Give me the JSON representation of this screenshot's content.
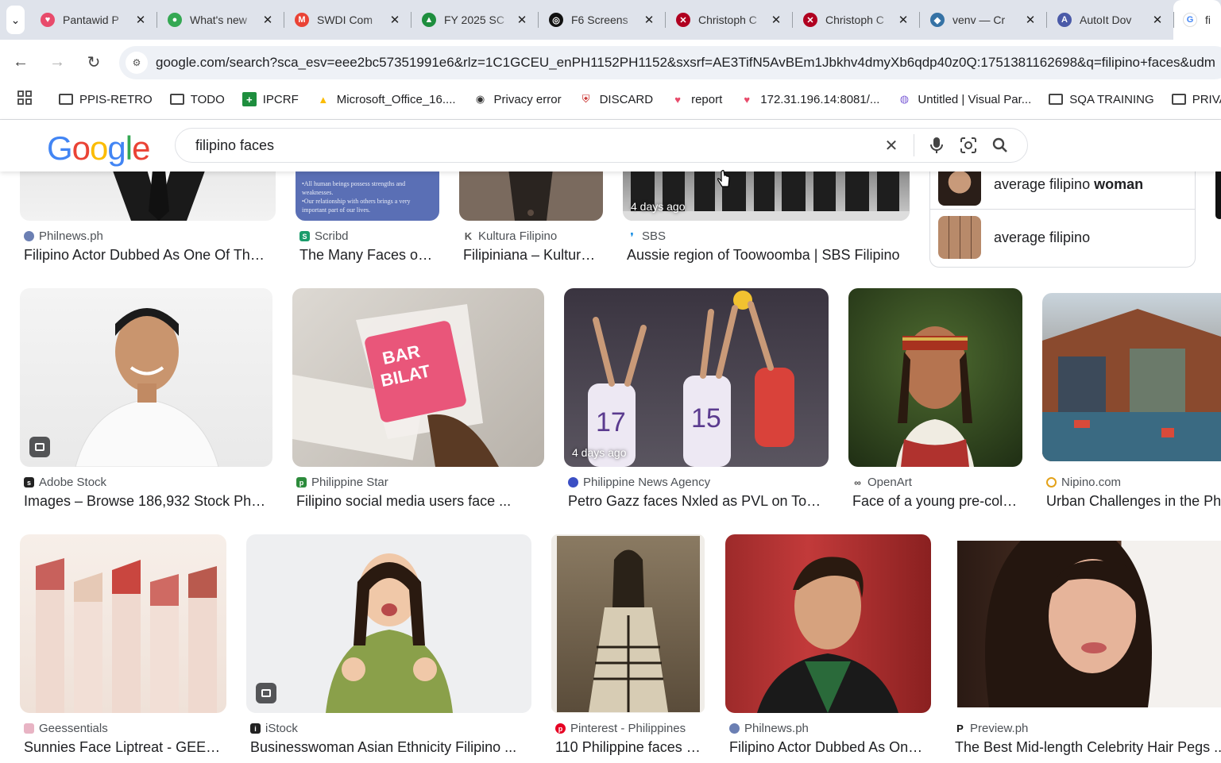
{
  "tabs": [
    {
      "title": "Pantawid P",
      "color": "#e84b6b",
      "glyph": "♥"
    },
    {
      "title": "What's new",
      "color": "#34a853",
      "glyph": "●"
    },
    {
      "title": "SWDI Com",
      "color": "#ea4335",
      "glyph": "M"
    },
    {
      "title": "FY 2025 SC",
      "color": "#1e8e3e",
      "glyph": "▲"
    },
    {
      "title": "F6 Screens",
      "color": "#111111",
      "glyph": "◎"
    },
    {
      "title": "Christoph C",
      "color": "#b00020",
      "glyph": "✕"
    },
    {
      "title": "Christoph C",
      "color": "#b00020",
      "glyph": "✕"
    },
    {
      "title": "venv — Cr",
      "color": "#3572a5",
      "glyph": "◆"
    },
    {
      "title": "AutoIt Dov",
      "color": "#4a5aa8",
      "glyph": "A"
    }
  ],
  "active_tab": {
    "title": "fi",
    "glyph": "G"
  },
  "url": "google.com/search?sca_esv=eee2bc57351991e6&rlz=1C1GCEU_enPH1152PH1152&sxsrf=AE3TifN5AvBEm1Jbkhv4dmyXb6qdp40z0Q:1751381162698&q=filipino+faces&udm",
  "bookmarks": [
    {
      "label": "PPIS-RETRO",
      "icon": "folder"
    },
    {
      "label": "TODO",
      "icon": "folder"
    },
    {
      "label": "IPCRF",
      "icon": "plus-green"
    },
    {
      "label": "Microsoft_Office_16....",
      "icon": "drive"
    },
    {
      "label": "Privacy error",
      "icon": "globe"
    },
    {
      "label": "DISCARD",
      "icon": "shield"
    },
    {
      "label": "report",
      "icon": "heart"
    },
    {
      "label": "172.31.196.14:8081/...",
      "icon": "heart"
    },
    {
      "label": "Untitled | Visual Par...",
      "icon": "visual"
    },
    {
      "label": "SQA TRAINING",
      "icon": "folder"
    },
    {
      "label": "PRIVATE",
      "icon": "folder"
    }
  ],
  "search": {
    "query": "filipino faces"
  },
  "logo": [
    "G",
    "o",
    "o",
    "g",
    "l",
    "e"
  ],
  "related": [
    {
      "prefix": "average filipino ",
      "bold": "woman"
    },
    {
      "prefix": "average filipino",
      "bold": ""
    }
  ],
  "row1": [
    {
      "source": "Philnews.ph",
      "title": "Filipino Actor Dubbed As One Of Th…",
      "icon_color": "#6b7fb3"
    },
    {
      "source": "Scribd",
      "title": "The Many Faces o…",
      "icon_color": "#1a9c6b"
    },
    {
      "source": "Kultura Filipino",
      "title": "Filipiniana – Kultur…",
      "icon_color": "#555555"
    },
    {
      "source": "SBS",
      "title": "Aussie region of Toowoomba | SBS Filipino",
      "icon_color": "#1a8fe3",
      "badge": "4 days ago"
    }
  ],
  "row2": [
    {
      "source": "Adobe Stock",
      "title": "Images – Browse 186,932 Stock Ph…",
      "icon_color": "#222222"
    },
    {
      "source": "Philippine Star",
      "title": "Filipino social media users face ...",
      "icon_color": "#2c8b3b"
    },
    {
      "source": "Philippine News Agency",
      "title": "Petro Gazz faces Nxled as PVL on To…",
      "icon_color": "#3b4fc4",
      "badge": "4 days ago"
    },
    {
      "source": "OpenArt",
      "title": "Face of a young pre-col…",
      "icon_color": "#444444"
    },
    {
      "source": "Nipino.com",
      "title": "Urban Challenges in the Ph",
      "icon_color": "#e3a21a"
    }
  ],
  "row3": [
    {
      "source": "Geessentials",
      "title": "Sunnies Face Liptreat - GEE…",
      "icon_color": "#e8b4c4"
    },
    {
      "source": "iStock",
      "title": "Businesswoman Asian Ethnicity Filipino ...",
      "icon_color": "#222222"
    },
    {
      "source": "Pinterest - Philippines",
      "title": "110 Philippine faces …",
      "icon_color": "#e60023"
    },
    {
      "source": "Philnews.ph",
      "title": "Filipino Actor Dubbed As On…",
      "icon_color": "#6b7fb3"
    },
    {
      "source": "Preview.ph",
      "title": "The Best Mid-length Celebrity Hair Pegs ...",
      "icon_color": "#111111"
    }
  ],
  "colors": {
    "g_blue": "#4285f4",
    "g_red": "#ea4335",
    "g_yellow": "#fbbc05",
    "g_green": "#34a853"
  }
}
